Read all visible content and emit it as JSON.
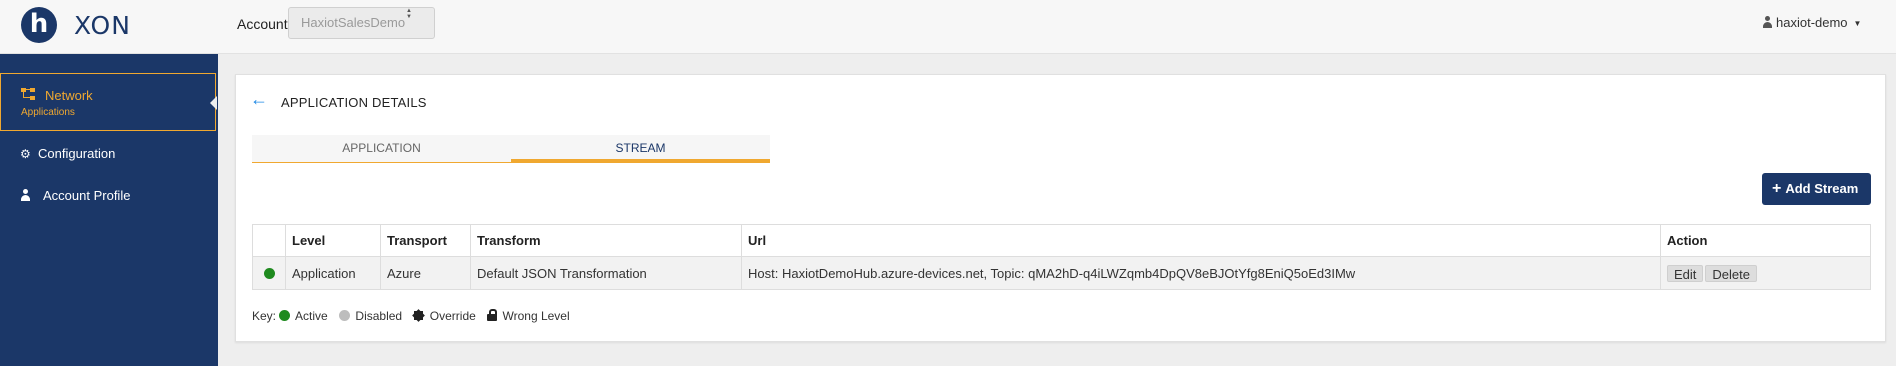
{
  "header": {
    "logo_letter": "h",
    "brand": "XON",
    "account_label": "Account",
    "account_selected": "HaxiotSalesDemo",
    "user_name": "haxiot-demo"
  },
  "sidebar": {
    "items": [
      {
        "label": "Network",
        "sublabel": "Applications",
        "active": true,
        "icon": "network-icon"
      },
      {
        "label": "Configuration",
        "icon": "gear-icon"
      },
      {
        "label": "Account Profile",
        "icon": "user-icon"
      }
    ]
  },
  "page": {
    "title": "APPLICATION DETAILS",
    "tabs": [
      {
        "label": "APPLICATION",
        "active": false
      },
      {
        "label": "STREAM",
        "active": true
      }
    ],
    "add_button": "Add Stream",
    "table": {
      "columns": [
        "",
        "Level",
        "Transport",
        "Transform",
        "Url",
        "Action"
      ],
      "rows": [
        {
          "status": "Active",
          "level": "Application",
          "transport": "Azure",
          "transform": "Default JSON Transformation",
          "url": "Host: HaxiotDemoHub.azure-devices.net, Topic: qMA2hD-q4iLWZqmb4DpQV8eBJOtYfg8EniQ5oEd3IMw",
          "actions": [
            "Edit",
            "Delete"
          ]
        }
      ]
    },
    "key": {
      "label": "Key:",
      "items": [
        "Active",
        "Disabled",
        "Override",
        "Wrong Level"
      ]
    }
  },
  "colors": {
    "primary": "#1b3768",
    "accent": "#f0a830",
    "active": "#1e8a1e",
    "disabled": "#bdbdbd",
    "link": "#1e88e5"
  }
}
